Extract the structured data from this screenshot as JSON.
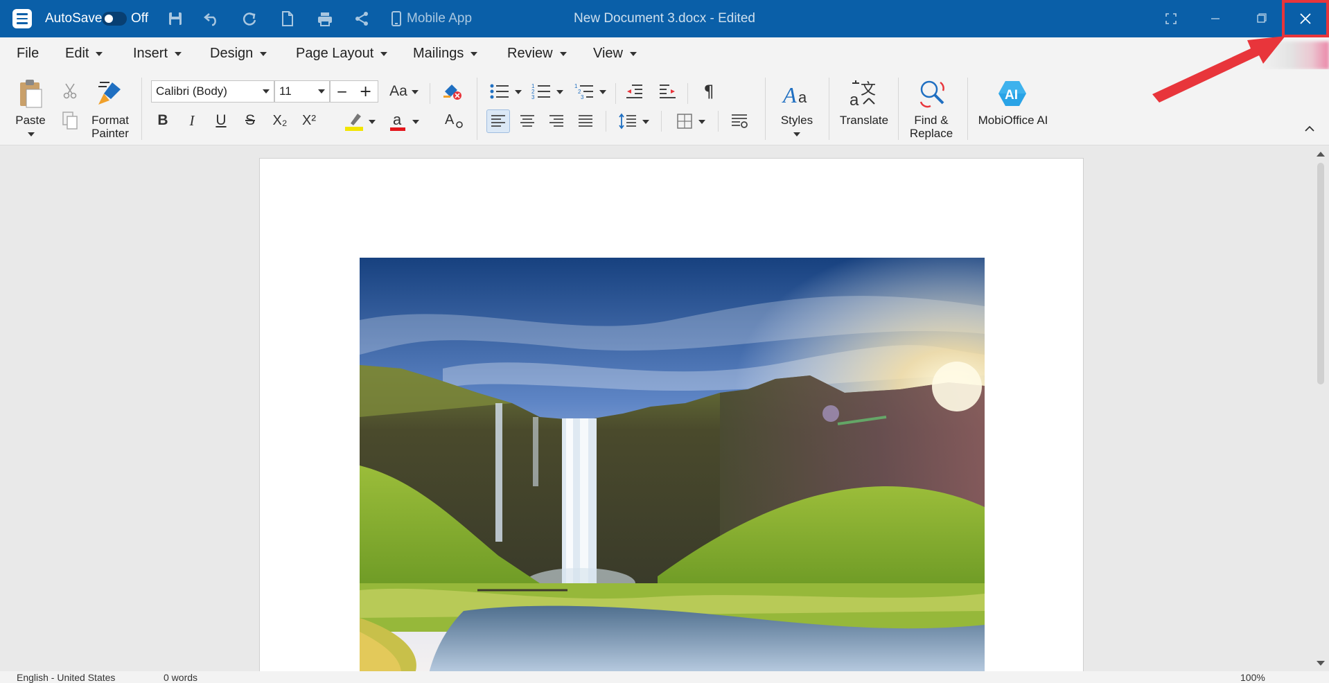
{
  "titlebar": {
    "autosave_label": "AutoSave",
    "autosave_state": "Off",
    "mobile_app": "Mobile App",
    "document_title": "New Document 3.docx - Edited",
    "bg_color": "#0a5fa8"
  },
  "menus": [
    "File",
    "Edit",
    "Insert",
    "Design",
    "Page Layout",
    "Mailings",
    "Review",
    "View"
  ],
  "ribbon": {
    "paste_label": "Paste",
    "format_painter_line1": "Format",
    "format_painter_line2": "Painter",
    "font_name": "Calibri (Body)",
    "font_size": "11",
    "change_case": "Aa",
    "bold": "B",
    "italic": "I",
    "underline": "U",
    "strike": "S",
    "subscript": "X₂",
    "superscript": "X²",
    "styles_label": "Styles",
    "translate_label": "Translate",
    "find_line1": "Find &",
    "find_line2": "Replace",
    "ai_label": "MobiOffice AI",
    "ai_badge": "AI"
  },
  "statusbar": {
    "language": "English - United States",
    "words": "0 words",
    "zoom": "100%"
  },
  "annotation": {
    "highlight_color": "#e8353b",
    "target": "close-button"
  }
}
